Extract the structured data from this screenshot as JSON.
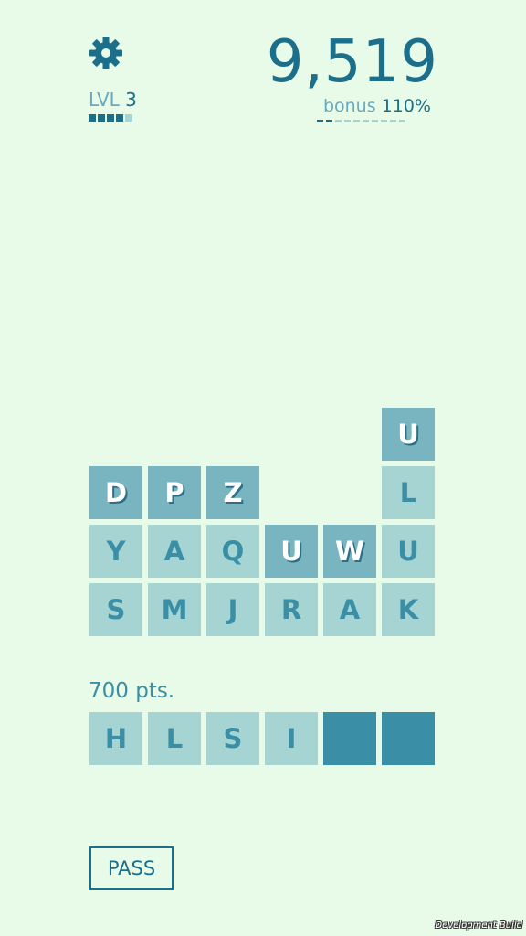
{
  "header": {
    "settings_icon": "gear-icon",
    "level_label": "LVL",
    "level_value": "3",
    "level_progress": {
      "filled": 4,
      "total": 5
    },
    "score": "9,519",
    "bonus_label": "bonus",
    "bonus_value": "110%",
    "bonus_progress": {
      "filled": 2,
      "total": 10
    }
  },
  "board": {
    "rows": [
      [
        "",
        "",
        "",
        "",
        "",
        "U"
      ],
      [
        "D",
        "P",
        "Z",
        "",
        "",
        "L"
      ],
      [
        "Y",
        "A",
        "Q",
        "U",
        "W",
        "U"
      ],
      [
        "S",
        "M",
        "J",
        "R",
        "A",
        "K"
      ]
    ],
    "highlighted": [
      [
        false,
        false,
        false,
        false,
        false,
        true
      ],
      [
        true,
        true,
        true,
        false,
        false,
        false
      ],
      [
        false,
        false,
        false,
        true,
        true,
        false
      ],
      [
        false,
        false,
        false,
        false,
        false,
        false
      ]
    ]
  },
  "word": {
    "points": "700 pts.",
    "letters": [
      "H",
      "L",
      "S",
      "I",
      "",
      ""
    ]
  },
  "pass_label": "PASS",
  "dev_label": "Development Build",
  "colors": {
    "background": "#e8fbe8",
    "primary": "#1b6f8a",
    "tile_light": "#a6d4d2",
    "tile_dark": "#78b5c0",
    "slot_empty": "#3a8fa6",
    "muted": "#6aa9bd"
  }
}
